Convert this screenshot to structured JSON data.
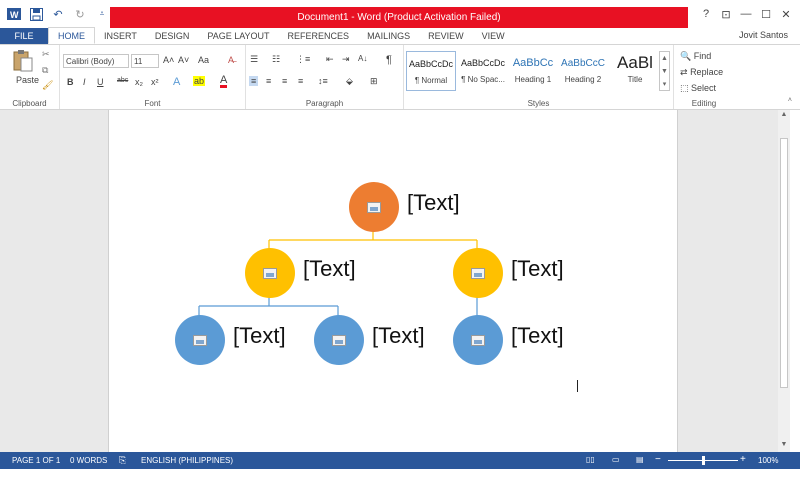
{
  "window": {
    "title": "Document1 - Word (Product Activation Failed)",
    "user": "Jovit Santos",
    "help": "?",
    "ribbon_opts": "⊡",
    "minimize": "—",
    "maximize": "☐",
    "close": "✕"
  },
  "qat": {
    "undo": "↶",
    "redo": "↻",
    "customize": "⩡"
  },
  "tabs": [
    "FILE",
    "HOME",
    "INSERT",
    "DESIGN",
    "PAGE LAYOUT",
    "REFERENCES",
    "MAILINGS",
    "REVIEW",
    "VIEW"
  ],
  "ribbon": {
    "clipboard": {
      "label": "Clipboard",
      "paste": "Paste"
    },
    "font": {
      "label": "Font",
      "family": "Calibri (Body)",
      "size": "11",
      "grow": "A˄",
      "shrink": "A˅",
      "case": "Aa",
      "clear": "A̶",
      "bold": "B",
      "italic": "I",
      "underline": "U",
      "strike": "abc",
      "sub": "x₂",
      "sup": "x²",
      "effects": "A",
      "highlight": "ab",
      "color": "A"
    },
    "paragraph": {
      "label": "Paragraph",
      "pilcrow": "¶",
      "sort": "A↓"
    },
    "styles": {
      "label": "Styles",
      "items": [
        {
          "sample": "AaBbCcDc",
          "name": "¶ Normal"
        },
        {
          "sample": "AaBbCcDc",
          "name": "¶ No Spac..."
        },
        {
          "sample": "AaBbCc",
          "name": "Heading 1"
        },
        {
          "sample": "AaBbCcC",
          "name": "Heading 2"
        },
        {
          "sample": "AaBl",
          "name": "Title"
        }
      ]
    },
    "editing": {
      "label": "Editing",
      "find": "Find",
      "replace": "Replace",
      "select": "Select"
    }
  },
  "diagram": {
    "nodes": [
      {
        "label": "[Text]",
        "color": "#ed7d31"
      },
      {
        "label": "[Text]",
        "color": "#ffc000"
      },
      {
        "label": "[Text]",
        "color": "#ffc000"
      },
      {
        "label": "[Text]",
        "color": "#5b9bd5"
      },
      {
        "label": "[Text]",
        "color": "#5b9bd5"
      },
      {
        "label": "[Text]",
        "color": "#5b9bd5"
      }
    ]
  },
  "status": {
    "page": "PAGE 1 OF 1",
    "words": "0 WORDS",
    "language": "ENGLISH (PHILIPPINES)",
    "zoom": "100%"
  },
  "colors": {
    "accent": "#2b579a",
    "titlebar_alert": "#e81123"
  }
}
